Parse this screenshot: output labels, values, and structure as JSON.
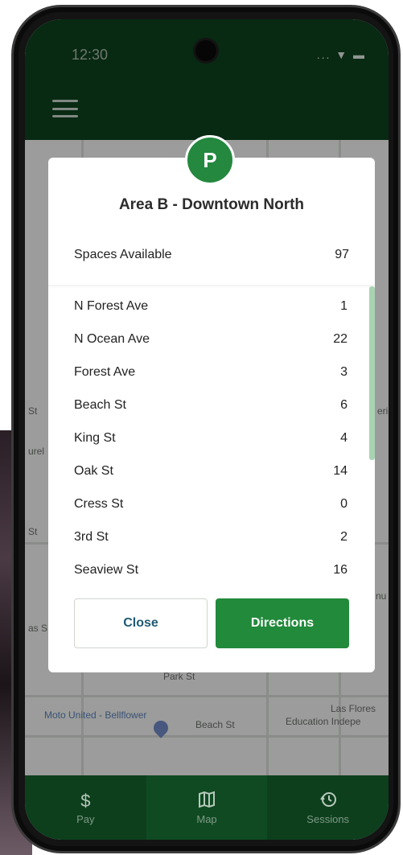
{
  "status_bar": {
    "time": "12:30",
    "icons": "... ▼ ▬"
  },
  "map": {
    "labels": [
      "Park St",
      "Moto United - Bellflower",
      "Beach St",
      "Las Flores",
      "Education Indepe",
      "St",
      "St",
      "urel",
      "as S",
      "nu",
      "eri"
    ]
  },
  "modal": {
    "badge": "P",
    "title": "Area B - Downtown North",
    "summary": {
      "label": "Spaces Available",
      "value": "97"
    },
    "streets": [
      {
        "name": "N Forest Ave",
        "spaces": "1"
      },
      {
        "name": "N Ocean Ave",
        "spaces": "22"
      },
      {
        "name": "Forest Ave",
        "spaces": "3"
      },
      {
        "name": "Beach St",
        "spaces": "6"
      },
      {
        "name": "King St",
        "spaces": "4"
      },
      {
        "name": "Oak St",
        "spaces": "14"
      },
      {
        "name": "Cress St",
        "spaces": "0"
      },
      {
        "name": "3rd St",
        "spaces": "2"
      },
      {
        "name": "Seaview St",
        "spaces": "16"
      }
    ],
    "close_label": "Close",
    "directions_label": "Directions"
  },
  "nav": {
    "pay": {
      "label": "Pay",
      "icon": "dollar-icon"
    },
    "map": {
      "label": "Map",
      "icon": "map-icon"
    },
    "sessions": {
      "label": "Sessions",
      "icon": "history-icon"
    }
  },
  "colors": {
    "brand_green": "#218a3b",
    "header_green": "#0d3f1d",
    "close_text": "#1f5a73"
  }
}
